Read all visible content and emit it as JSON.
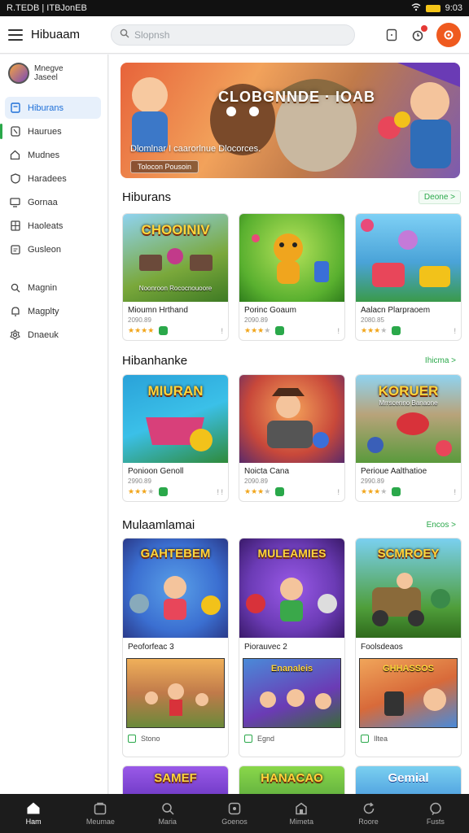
{
  "status": {
    "left": "R.TEDB | ITBJonEB",
    "right": "9:03"
  },
  "header": {
    "title": "Hibuaam",
    "search_placeholder": "Slopnsh"
  },
  "sidebar": {
    "profile_name": "Mnegve\nJaseel",
    "items": [
      {
        "label": "Hiburans",
        "icon": "book-icon"
      },
      {
        "label": "Haurues",
        "icon": "gamepad-icon"
      },
      {
        "label": "Mudnes",
        "icon": "home-icon"
      },
      {
        "label": "Haradees",
        "icon": "shield-icon"
      },
      {
        "label": "Gornaa",
        "icon": "monitor-icon"
      },
      {
        "label": "Haoleats",
        "icon": "grid-icon"
      },
      {
        "label": "Gusleon",
        "icon": "box-icon"
      }
    ],
    "items2": [
      {
        "label": "Magnin",
        "icon": "search-icon"
      },
      {
        "label": "Magplty",
        "icon": "bell-icon"
      },
      {
        "label": "Dnaeuk",
        "icon": "gear-icon"
      }
    ]
  },
  "hero": {
    "title": "CLOBGNNDE · IOAB",
    "subtitle": "Dlomlnar I caarorlnue Dlocorces.",
    "button": "Tolocon Pousoin"
  },
  "sections": [
    {
      "title": "Hiburans",
      "more": "Deone >",
      "cards": [
        {
          "thumb_text": "CHOOINIV",
          "thumb_caption": "Noonroon Rococnouoore",
          "title": "Mioumn Hrthand",
          "sub": "2090.89",
          "stars": 4,
          "more": "!",
          "color": "#7aa83b"
        },
        {
          "title": "Porinc Goaum",
          "sub": "2090.89",
          "stars": 3,
          "more": "!",
          "thumb_text": "",
          "thumb_caption": "",
          "color": "#f0a51e"
        },
        {
          "title": "Aalacn Plarpraoem",
          "sub": "2080.85",
          "stars": 3,
          "more": "!",
          "thumb_text": "",
          "thumb_caption": "",
          "color": "#4aa3d8"
        }
      ]
    },
    {
      "title": "Hibanhanke",
      "more": "Ihicma >",
      "cards": [
        {
          "thumb_text": "MIURAN",
          "thumb_caption": "",
          "title": "Ponioon Genoll",
          "sub": "2990.89",
          "stars": 3,
          "more": "! !",
          "color": "#2aa2d9"
        },
        {
          "thumb_text": "",
          "thumb_caption": "",
          "title": "Noicta Cana",
          "sub": "2090.89",
          "stars": 3,
          "more": "!",
          "color": "#c8483a"
        },
        {
          "thumb_text": "KORUER",
          "thumb_caption": "Mrrscenno Banaone",
          "title": "Perioue Aalthatioe",
          "sub": "2990.89",
          "stars": 3,
          "more": "!",
          "color": "#5a9a3c"
        }
      ]
    },
    {
      "title": "Mulaamlamai",
      "more": "Encos >",
      "cards": [
        {
          "thumb_text": "GAHTEBEM",
          "title": "Peoforfeac 3",
          "thumb2_text": "",
          "foot": "Stono",
          "color": "#3b6fd1"
        },
        {
          "thumb_text": "MULEAMIES",
          "title": "Piorauvec 2",
          "thumb2_text": "Enanaleis",
          "foot": "Egnd",
          "color": "#6b3bb5"
        },
        {
          "thumb_text": "SCMROEY",
          "title": "Foolsdeaos",
          "thumb2_text": "GHHASSOS",
          "foot": "Iltea",
          "color": "#4f9e3a"
        }
      ]
    }
  ],
  "peek": [
    "SAMEF",
    "HANACAO",
    "Gemial"
  ],
  "bottomnav": [
    {
      "label": "Ham",
      "icon": "home-icon",
      "active": true
    },
    {
      "label": "Meumae",
      "icon": "bag-icon",
      "active": false
    },
    {
      "label": "Maria",
      "icon": "search-icon",
      "active": false
    },
    {
      "label": "Goenos",
      "icon": "controller-icon",
      "active": false
    },
    {
      "label": "Mimeta",
      "icon": "store-icon",
      "active": false
    },
    {
      "label": "Roore",
      "icon": "refresh-icon",
      "active": false
    },
    {
      "label": "Fusts",
      "icon": "chat-icon",
      "active": false
    }
  ]
}
